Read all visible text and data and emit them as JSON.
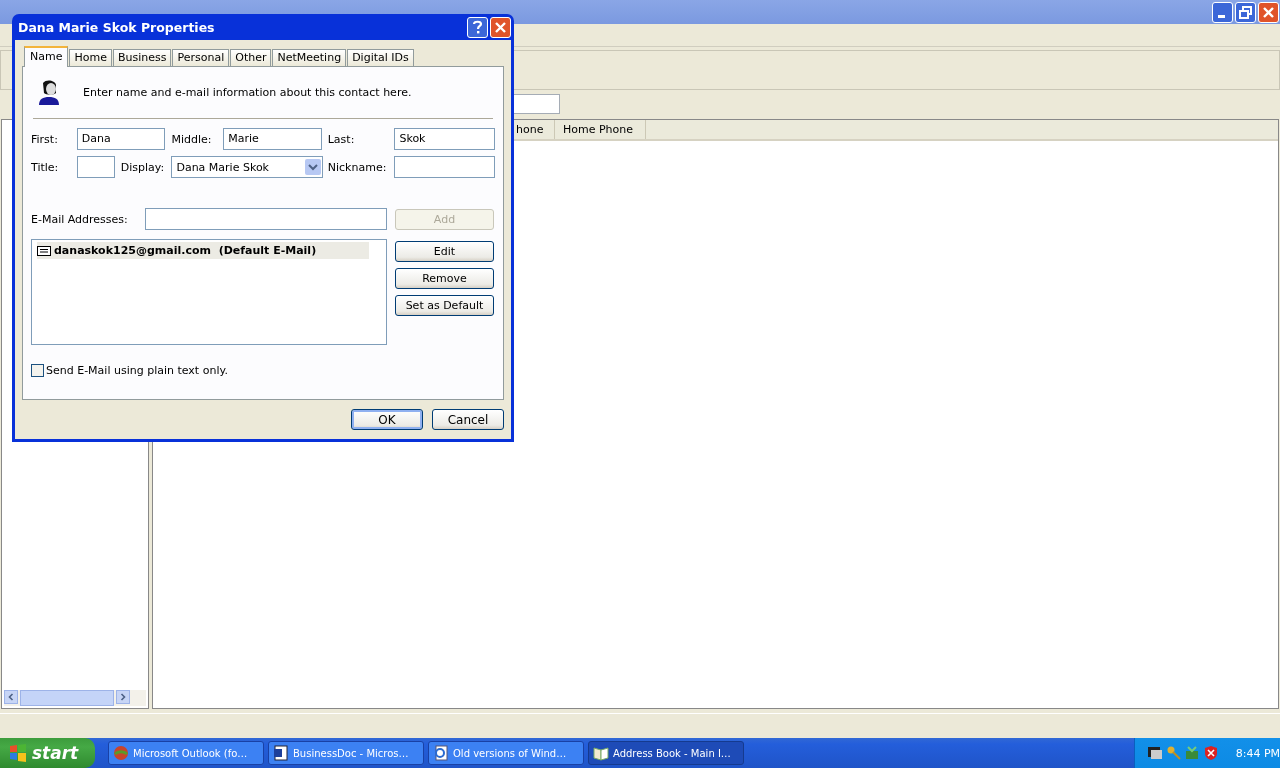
{
  "contact_list": {
    "columns": [
      {
        "label": "hone"
      },
      {
        "label": "Home Phone"
      }
    ]
  },
  "dialog": {
    "title": "Dana Marie Skok Properties",
    "tabs": [
      {
        "label": "Name",
        "selected": true
      },
      {
        "label": "Home",
        "selected": false
      },
      {
        "label": "Business",
        "selected": false
      },
      {
        "label": "Personal",
        "selected": false
      },
      {
        "label": "Other",
        "selected": false
      },
      {
        "label": "NetMeeting",
        "selected": false
      },
      {
        "label": "Digital IDs",
        "selected": false
      }
    ],
    "intro": "Enter name and e-mail information about this contact here.",
    "name_rows": [
      [
        {
          "label": "First:",
          "value": "Dana",
          "kind": "text"
        },
        {
          "label": "Middle:",
          "value": "Marie",
          "kind": "text"
        },
        {
          "label": "Last:",
          "value": "Skok",
          "kind": "text"
        }
      ],
      [
        {
          "label": "Title:",
          "kind": "text"
        },
        {
          "label": "Display:",
          "value": "Dana Marie Skok",
          "kind": "dropdown"
        },
        {
          "label": "Nickname:",
          "kind": "text"
        }
      ]
    ],
    "email": {
      "label": "E-Mail Addresses:",
      "add_button": {
        "label": "Add",
        "disabled": true
      },
      "addresses": [
        {
          "address": "danaskok125@gmail.com",
          "note": "(Default E-Mail)",
          "selected": true
        }
      ],
      "buttons": [
        {
          "label": "Edit",
          "disabled": false
        },
        {
          "label": "Remove",
          "disabled": false
        },
        {
          "label": "Set as Default",
          "disabled": false
        }
      ]
    },
    "plain_text": {
      "label": "Send E-Mail using plain text only.",
      "checked": false
    },
    "footer_buttons": [
      {
        "label": "OK",
        "default": true
      },
      {
        "label": "Cancel",
        "default": false
      }
    ]
  },
  "taskbar": {
    "start": "start",
    "tasks": [
      {
        "label": "Microsoft Outlook (fo…",
        "kind": "outlook",
        "selected": false
      },
      {
        "label": "BusinessDoc - Micros…",
        "kind": "word",
        "selected": false
      },
      {
        "label": "Old versions of Wind…",
        "kind": "ie",
        "selected": false
      },
      {
        "label": "Address Book - Main I…",
        "kind": "book",
        "selected": true
      }
    ],
    "clock": "8:44 PM"
  }
}
